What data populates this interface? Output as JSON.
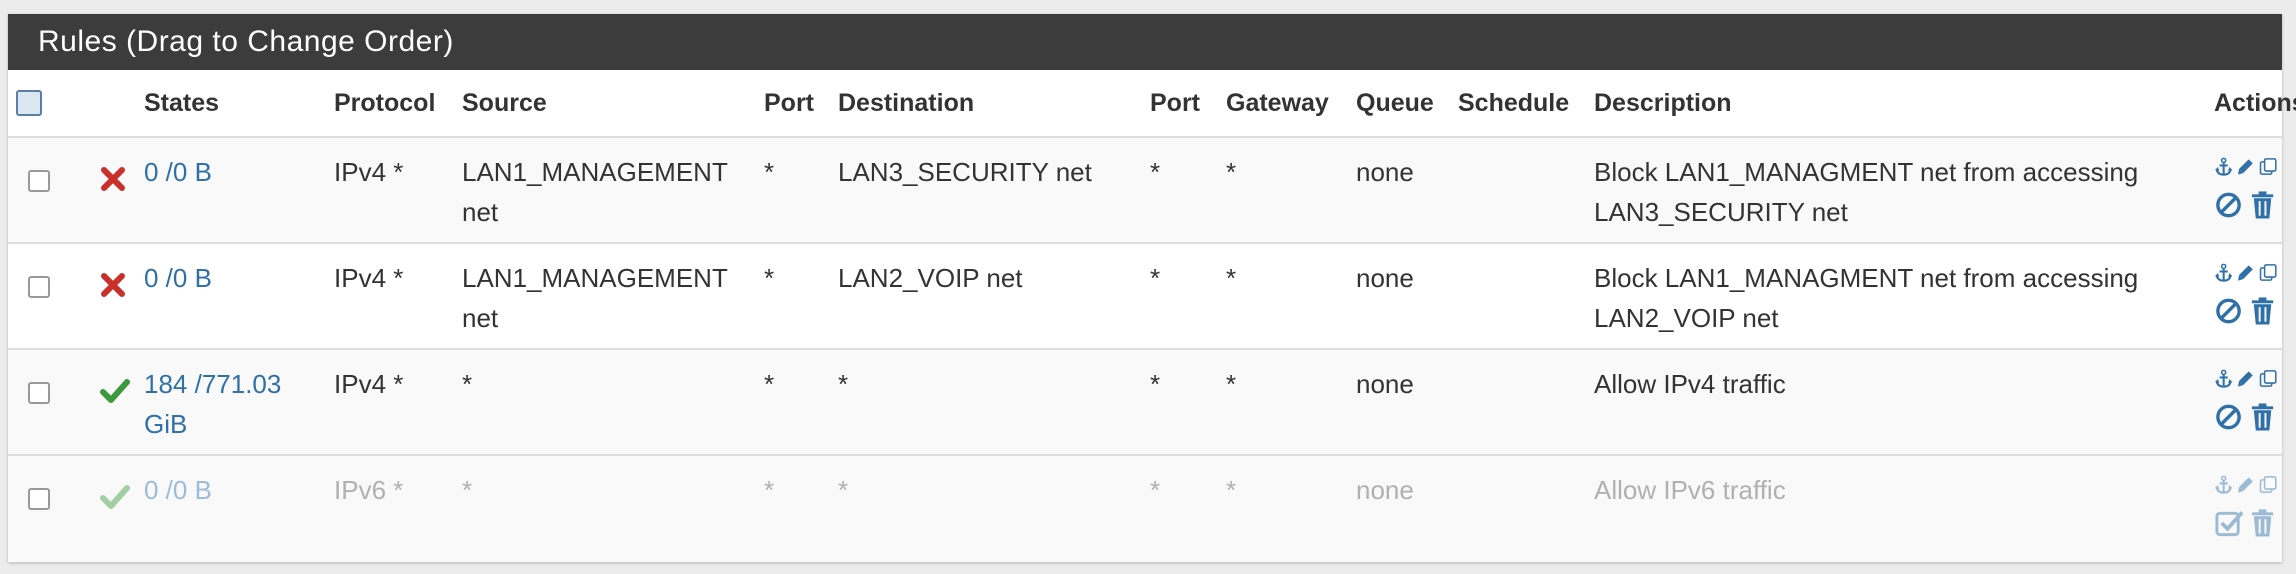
{
  "panel": {
    "title": "Rules (Drag to Change Order)"
  },
  "columns": {
    "states": "States",
    "protocol": "Protocol",
    "source": "Source",
    "port": "Port",
    "destination": "Destination",
    "port2": "Port",
    "gateway": "Gateway",
    "queue": "Queue",
    "schedule": "Schedule",
    "description": "Description",
    "actions": "Actions"
  },
  "rules": [
    {
      "action": "block",
      "states": "0 /0 B",
      "protocol": "IPv4 *",
      "source": "LAN1_MANAGEMENT net",
      "source_port": "*",
      "destination": "LAN3_SECURITY net",
      "destination_port": "*",
      "gateway": "*",
      "queue": "none",
      "schedule": "",
      "description": "Block LAN1_MANAGMENT net from accessing LAN3_SECURITY net",
      "enabled": true
    },
    {
      "action": "block",
      "states": "0 /0 B",
      "protocol": "IPv4 *",
      "source": "LAN1_MANAGEMENT net",
      "source_port": "*",
      "destination": "LAN2_VOIP net",
      "destination_port": "*",
      "gateway": "*",
      "queue": "none",
      "schedule": "",
      "description": "Block LAN1_MANAGMENT net from accessing LAN2_VOIP net",
      "enabled": true
    },
    {
      "action": "pass",
      "states": "184 /771.03 GiB",
      "protocol": "IPv4 *",
      "source": "*",
      "source_port": "*",
      "destination": "*",
      "destination_port": "*",
      "gateway": "*",
      "queue": "none",
      "schedule": "",
      "description": "Allow IPv4 traffic",
      "enabled": true
    },
    {
      "action": "pass",
      "states": "0 /0 B",
      "protocol": "IPv6 *",
      "source": "*",
      "source_port": "*",
      "destination": "*",
      "destination_port": "*",
      "gateway": "*",
      "queue": "none",
      "schedule": "",
      "description": "Allow IPv6 traffic",
      "enabled": false
    }
  ],
  "icons": {
    "block": "x-mark-icon",
    "pass": "checkmark-icon",
    "anchor": "anchor-icon",
    "edit": "pencil-icon",
    "copy": "copy-icon",
    "disable": "disable-icon",
    "enable": "enable-icon",
    "delete": "trash-icon"
  },
  "colors": {
    "header_bg": "#3c3c3c",
    "link": "#3070a8",
    "block": "#c9302c",
    "pass": "#3c9a3c",
    "action_icon": "#3070a8"
  }
}
